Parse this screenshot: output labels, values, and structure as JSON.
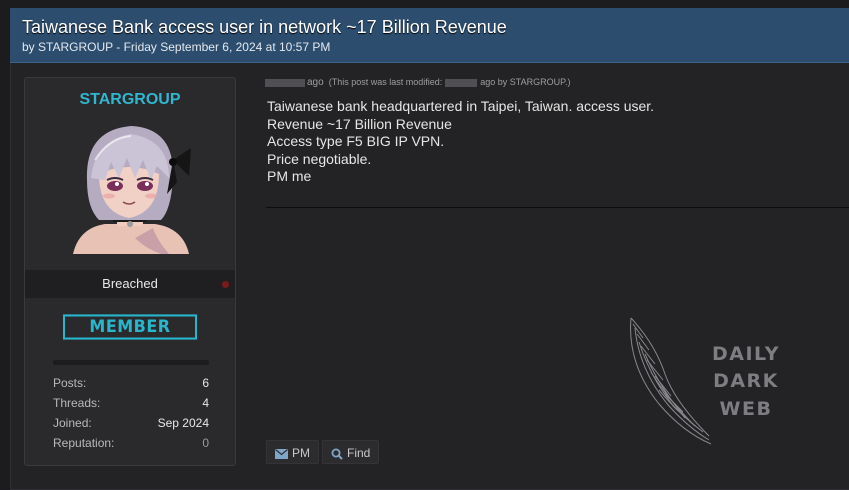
{
  "thread": {
    "title": "Taiwanese Bank access user in network ~17 Billion Revenue",
    "meta": "by STARGROUP - Friday September 6, 2024 at 10:57 PM"
  },
  "user": {
    "name": "STARGROUP",
    "status": "Breached",
    "rank": "MEMBER",
    "stats": [
      {
        "label": "Posts:",
        "value": "6"
      },
      {
        "label": "Threads:",
        "value": "4"
      },
      {
        "label": "Joined:",
        "value": "Sep 2024"
      },
      {
        "label": "Reputation:",
        "value": "0"
      }
    ]
  },
  "post": {
    "ago": "ago",
    "modified_prefix": "(This post was last modified:",
    "modified_suffix": "ago by STARGROUP.)",
    "lines": [
      "Taiwanese bank headquartered in Taipei, Taiwan.  access user.",
      "Revenue ~17 Billion Revenue",
      "Access type F5 BIG IP VPN.",
      "Price negotiable.",
      "PM me"
    ]
  },
  "buttons": {
    "pm": "PM",
    "find": "Find"
  },
  "watermark": {
    "line1": "DAILY",
    "line2": "DARK",
    "line3": "WEB"
  },
  "colors": {
    "header": "#2c4d6e",
    "accent": "#27b7cc",
    "status_dot": "#7a1a1a"
  },
  "icons": [
    "envelope-icon",
    "search-icon",
    "wing-icon"
  ]
}
